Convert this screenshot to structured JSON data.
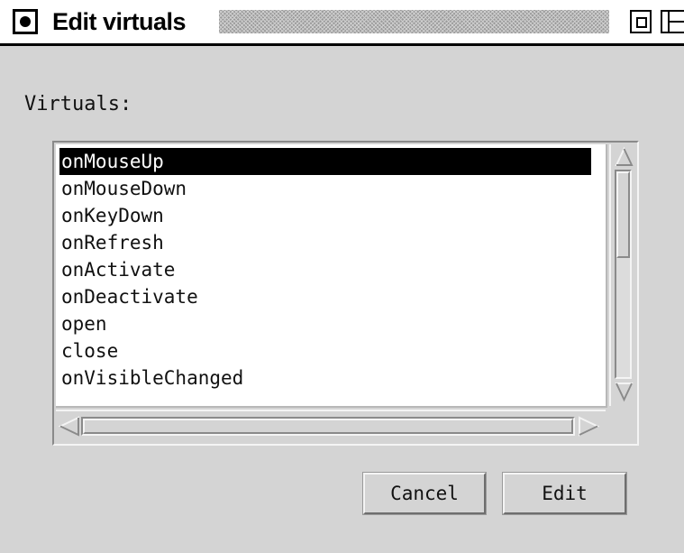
{
  "window": {
    "title": "Edit virtuals"
  },
  "dialog": {
    "label": "Virtuals:",
    "list": {
      "selected_index": 0,
      "items": [
        "onMouseUp",
        "onMouseDown",
        "onKeyDown",
        "onRefresh",
        "onActivate",
        "onDeactivate",
        "open",
        "close",
        "onVisibleChanged"
      ]
    },
    "buttons": {
      "cancel": "Cancel",
      "edit": "Edit"
    }
  },
  "colors": {
    "dialog_background": "#d4d4d4",
    "selection_background": "#000000",
    "selection_text": "#ffffff"
  },
  "icons": {
    "close_box": "close-box-icon",
    "zoom_box": "zoom-box-icon",
    "collapse_box": "collapse-box-icon",
    "scroll_up": "arrow-up-icon",
    "scroll_down": "arrow-down-icon",
    "scroll_left": "arrow-left-icon",
    "scroll_right": "arrow-right-icon"
  }
}
